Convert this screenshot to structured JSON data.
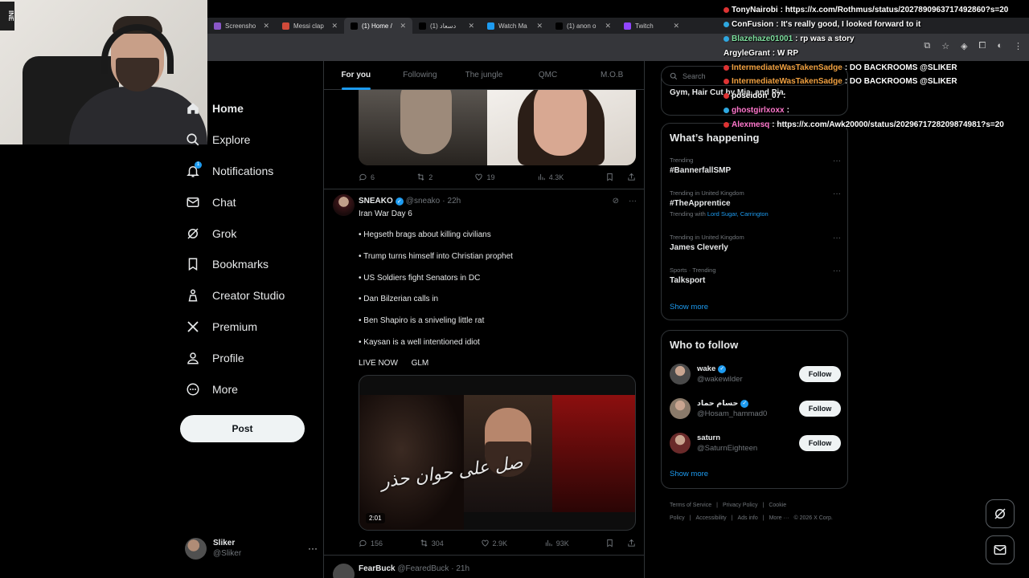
{
  "browser": {
    "tabs": [
      {
        "label": "Screensho",
        "fav_color": "#8a57c7",
        "active": false
      },
      {
        "label": "Messi clap",
        "fav_color": "#d04a3a",
        "active": false
      },
      {
        "label": "(1) Home /",
        "fav_color": "#000000",
        "active": true
      },
      {
        "label": "(1) دسعاد",
        "fav_color": "#000000",
        "active": false
      },
      {
        "label": "Watch Ma",
        "fav_color": "#1d9bf0",
        "active": false
      },
      {
        "label": "(1) anon o",
        "fav_color": "#000000",
        "active": false
      },
      {
        "label": "Twitch",
        "fav_color": "#9146ff",
        "active": false
      }
    ]
  },
  "webcam": {
    "sign_text": "INE"
  },
  "nav": {
    "items": [
      {
        "label": "Home",
        "icon": "home-icon"
      },
      {
        "label": "Explore",
        "icon": "search-icon"
      },
      {
        "label": "Notifications",
        "icon": "bell-icon",
        "badge": "1"
      },
      {
        "label": "Chat",
        "icon": "mail-icon"
      },
      {
        "label": "Grok",
        "icon": "grok-icon"
      },
      {
        "label": "Bookmarks",
        "icon": "bookmark-icon"
      },
      {
        "label": "Creator Studio",
        "icon": "creator-icon"
      },
      {
        "label": "Premium",
        "icon": "x-logo-icon"
      },
      {
        "label": "Profile",
        "icon": "person-icon"
      },
      {
        "label": "More",
        "icon": "more-circle-icon"
      }
    ],
    "post_label": "Post",
    "account": {
      "name": "Sliker",
      "handle": "@Sliker"
    }
  },
  "feed": {
    "tabs": [
      "For you",
      "Following",
      "The jungle",
      "QMC",
      "M.O.B"
    ],
    "post1": {
      "replies": "6",
      "reposts": "2",
      "likes": "19",
      "views": "4.3K"
    },
    "post2": {
      "name": "SNEAKO",
      "handle": "@sneako",
      "time": "22h",
      "lines": [
        "Iran War Day 6",
        "• Hegseth brags about killing civilians",
        "• Trump turns himself into Christian prophet",
        "• US Soldiers fight Senators in DC",
        "• Dan Bilzerian calls in",
        "• Ben Shapiro is a sniveling little rat",
        "• Kaysan is a well intentioned idiot",
        "LIVE NOW      GLM"
      ],
      "video_duration": "2:01",
      "video_caption": "صل على حوان حذر",
      "replies": "156",
      "reposts": "304",
      "likes": "2.9K",
      "views": "93K"
    },
    "post3": {
      "name": "FearBuck",
      "handle": "@FearedBuck",
      "time": "21h"
    }
  },
  "right": {
    "search_placeholder": "Search",
    "partial_text": "Gym, Hair Cut by Mia, and Pia",
    "happening": {
      "title": "What’s happening",
      "trends": [
        {
          "meta": "Trending",
          "name": "#BannerfallSMP",
          "with_prefix": "",
          "with_links": ""
        },
        {
          "meta": "Trending in United Kingdom",
          "name": "#TheApprentice",
          "with_prefix": "Trending with",
          "with_links": "Lord Sugar, Carrington"
        },
        {
          "meta": "Trending in United Kingdom",
          "name": "James Cleverly",
          "with_prefix": "",
          "with_links": ""
        },
        {
          "meta": "Sports · Trending",
          "name": "Talksport",
          "with_prefix": "",
          "with_links": ""
        }
      ],
      "show_more": "Show more"
    },
    "who_to_follow": {
      "title": "Who to follow",
      "accounts": [
        {
          "name": "wake",
          "handle": "@wakewilder",
          "verified": true,
          "avatar_color": "#4a4a4a"
        },
        {
          "name": "حسام حماد",
          "handle": "@Hosam_hammad0",
          "verified": true,
          "avatar_color": "#8a7a6a"
        },
        {
          "name": "saturn",
          "handle": "@SaturnEighteen",
          "verified": false,
          "avatar_color": "#6a2a2a"
        }
      ],
      "follow_label": "Follow",
      "show_more": "Show more"
    },
    "footer": [
      "Terms of Service",
      "|",
      "Privacy Policy",
      "|",
      "Cookie Policy",
      "|",
      "Accessibility",
      "|",
      "Ads info",
      "|",
      "More ···",
      "© 2026 X Corp."
    ]
  },
  "chat": [
    {
      "user": "TonyNairobi",
      "user_color": "#ffffff",
      "msg": ": https://x.com/Rothmus/status/2027890963717492860?s=20",
      "ico": "r"
    },
    {
      "user": "ConFusion",
      "user_color": "#ffffff",
      "msg": ": It's really good, I looked forward to it",
      "ico": "b"
    },
    {
      "user": "Blazehaze01001",
      "user_color": "#7fe0a0",
      "msg": ": rp was a story",
      "ico": "b"
    },
    {
      "user": "ArgyleGrant",
      "user_color": "#ffffff",
      "msg": ": W RP",
      "ico": ""
    },
    {
      "user": "IntermediateWasTakenSadge",
      "user_color": "#f0a040",
      "msg": ": DO BACKROOMS @SLIKER",
      "ico": "r"
    },
    {
      "user": "IntermediateWasTakenSadge",
      "user_color": "#f0a040",
      "msg": ": DO BACKROOMS @SLIKER",
      "ico": "r"
    },
    {
      "user": "poseidon_07",
      "user_color": "#ffffff",
      "msg": ":",
      "ico": "r"
    },
    {
      "user": "ghostgirlxoxx",
      "user_color": "#ff77cc",
      "msg": ":",
      "ico": "b"
    },
    {
      "user": "Alexmesq",
      "user_color": "#ff77cc",
      "msg": ": https://x.com/Awk20000/status/2029671728209874981?s=20",
      "ico": "r"
    }
  ]
}
